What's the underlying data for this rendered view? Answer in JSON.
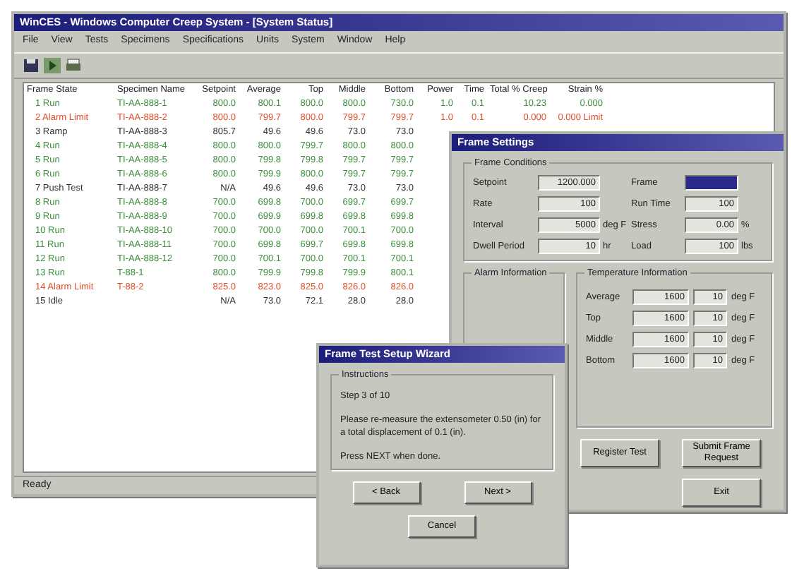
{
  "main_window": {
    "title": "WinCES - Windows Computer Creep System - [System Status]",
    "menu": [
      "File",
      "View",
      "Tests",
      "Specimens",
      "Specifications",
      "Units",
      "System",
      "Window",
      "Help"
    ],
    "toolbar": [
      {
        "kind": "save"
      },
      {
        "kind": "run"
      },
      {
        "kind": "print"
      }
    ],
    "table": {
      "columns": [
        "Frame State",
        "Specimen Name",
        "Setpoint",
        "Average",
        "Top",
        "Middle",
        "Bottom",
        "Power",
        "Time",
        "Total % Creep",
        "Strain %"
      ],
      "rows": [
        {
          "kind": "run",
          "cells": [
            "1 Run",
            "TI-AA-888-1",
            "800.0",
            "800.1",
            "800.0",
            "800.0",
            "730.0",
            "1.0",
            "0.1",
            "10.23",
            "0.000"
          ]
        },
        {
          "kind": "alarm",
          "cells": [
            "2 Alarm Limit",
            "TI-AA-888-2",
            "800.0",
            "799.7",
            "800.0",
            "799.7",
            "799.7",
            "1.0",
            "0.1",
            "0.000",
            "0.000 Limit"
          ]
        },
        {
          "kind": "idle",
          "cells": [
            "3 Ramp",
            "TI-AA-888-3",
            "805.7",
            "49.6",
            "49.6",
            "73.0",
            "73.0"
          ]
        },
        {
          "kind": "run",
          "cells": [
            "4 Run",
            "TI-AA-888-4",
            "800.0",
            "800.0",
            "799.7",
            "800.0",
            "800.0"
          ]
        },
        {
          "kind": "run",
          "cells": [
            "5 Run",
            "TI-AA-888-5",
            "800.0",
            "799.8",
            "799.8",
            "799.7",
            "799.7"
          ]
        },
        {
          "kind": "run",
          "cells": [
            "6 Run",
            "TI-AA-888-6",
            "800.0",
            "799.9",
            "800.0",
            "799.7",
            "799.7"
          ]
        },
        {
          "kind": "idle",
          "cells": [
            "7 Push Test",
            "TI-AA-888-7",
            "N/A",
            "49.6",
            "49.6",
            "73.0",
            "73.0"
          ]
        },
        {
          "kind": "run",
          "cells": [
            "8 Run",
            "TI-AA-888-8",
            "700.0",
            "699.8",
            "700.0",
            "699.7",
            "699.7"
          ]
        },
        {
          "kind": "run",
          "cells": [
            "9 Run",
            "TI-AA-888-9",
            "700.0",
            "699.9",
            "699.8",
            "699.8",
            "699.8"
          ]
        },
        {
          "kind": "run",
          "cells": [
            "10 Run",
            "TI-AA-888-10",
            "700.0",
            "700.0",
            "700.0",
            "700.1",
            "700.0"
          ]
        },
        {
          "kind": "run",
          "cells": [
            "11 Run",
            "TI-AA-888-11",
            "700.0",
            "699.8",
            "699.7",
            "699.8",
            "699.8"
          ]
        },
        {
          "kind": "run",
          "cells": [
            "12 Run",
            "TI-AA-888-12",
            "700.0",
            "700.1",
            "700.0",
            "700.1",
            "700.1"
          ]
        },
        {
          "kind": "run",
          "cells": [
            "13 Run",
            "T-88-1",
            "800.0",
            "799.9",
            "799.8",
            "799.9",
            "800.1"
          ]
        },
        {
          "kind": "alarm",
          "cells": [
            "14 Alarm Limit",
            "T-88-2",
            "825.0",
            "823.0",
            "825.0",
            "826.0",
            "826.0"
          ]
        },
        {
          "kind": "idle",
          "cells": [
            "15 Idle",
            "",
            "N/A",
            "73.0",
            "72.1",
            "28.0",
            "28.0"
          ]
        }
      ]
    },
    "status_bar": "Ready"
  },
  "settings_window": {
    "title": "Frame Settings",
    "conditions": {
      "title": "Frame Conditions",
      "fields": [
        {
          "label": "Setpoint",
          "value": "1200.000"
        },
        {
          "label": "Frame",
          "kind": "select",
          "selected": true
        },
        {
          "label": "Rate",
          "value": "100"
        },
        {
          "label": "Run Time",
          "value": "100"
        },
        {
          "label": "Interval",
          "value": "5000",
          "unit": "deg F"
        },
        {
          "label": "Stress",
          "value": "0.00",
          "unit": "%"
        },
        {
          "label": "Dwell Period",
          "value": "10",
          "unit": "hr"
        },
        {
          "label": "Load",
          "value": "100",
          "unit": "lbs"
        }
      ]
    },
    "alarm": {
      "title": "Alarm Information"
    },
    "temperature": {
      "title": "Temperature Information",
      "rows": [
        {
          "label": "Average",
          "value": "1600",
          "tolerance": "10",
          "unit": "deg F"
        },
        {
          "label": "Top",
          "value": "1600",
          "tolerance": "10",
          "unit": "deg F"
        },
        {
          "label": "Middle",
          "value": "1600",
          "tolerance": "10",
          "unit": "deg F"
        },
        {
          "label": "Bottom",
          "value": "1600",
          "tolerance": "10",
          "unit": "deg F"
        }
      ]
    },
    "buttons": [
      "Register Test",
      "Submit Frame Request"
    ],
    "exit_button": "Exit"
  },
  "wizard_window": {
    "title": "Frame Test Setup Wizard",
    "group": "Instructions",
    "step": "Step 3 of 10",
    "message": "Please re-measure the extensometer 0.50 (in) for a total displacement of 0.1 (in).",
    "hint": "Press NEXT when done.",
    "nav_buttons": [
      "< Back",
      "Next >"
    ],
    "cancel": "Cancel"
  }
}
